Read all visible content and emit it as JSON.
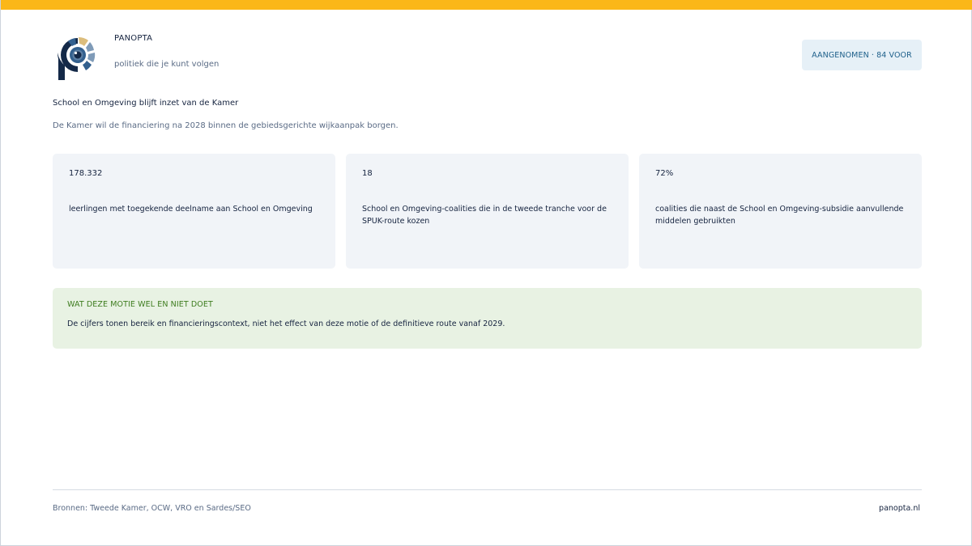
{
  "colors": {
    "accent_bar": "#fbb718",
    "brand_navy": "#142948",
    "logo_blue": "#33608e",
    "logo_light": "#7f9bb8",
    "logo_gold": "#dcbd7c",
    "badge_bg": "#e6f0f7",
    "badge_text": "#1d5f8a",
    "note_bg": "#e8f2e3",
    "note_title": "#3d7c1e"
  },
  "header": {
    "logo_icon": "panopta-eye-logo-icon",
    "brand_name": "PANOPTA",
    "tagline": "politiek die je kunt volgen",
    "status_badge": "AANGENOMEN · 84 VOOR"
  },
  "article": {
    "headline": "School en Omgeving blijft inzet van de Kamer",
    "subline": "De Kamer wil de financiering na 2028 binnen de gebiedsgerichte wijkaanpak borgen."
  },
  "stats": [
    {
      "value": "178.332",
      "label": "leerlingen met toegekende deelname aan School en Omgeving"
    },
    {
      "value": "18",
      "label": "School en Omgeving-coalities die in de tweede tranche voor de SPUK-route kozen"
    },
    {
      "value": "72%",
      "label": "coalities die naast de School en Omgeving-subsidie aanvullende middelen gebruikten"
    }
  ],
  "note": {
    "title": "WAT DEZE MOTIE WEL EN NIET DOET",
    "text": "De cijfers tonen bereik en financieringscontext, niet het effect van deze motie of de definitieve route vanaf 2029."
  },
  "footer": {
    "sources": "Bronnen: Tweede Kamer, OCW, VRO en Sardes/SEO",
    "site": "panopta.nl"
  }
}
